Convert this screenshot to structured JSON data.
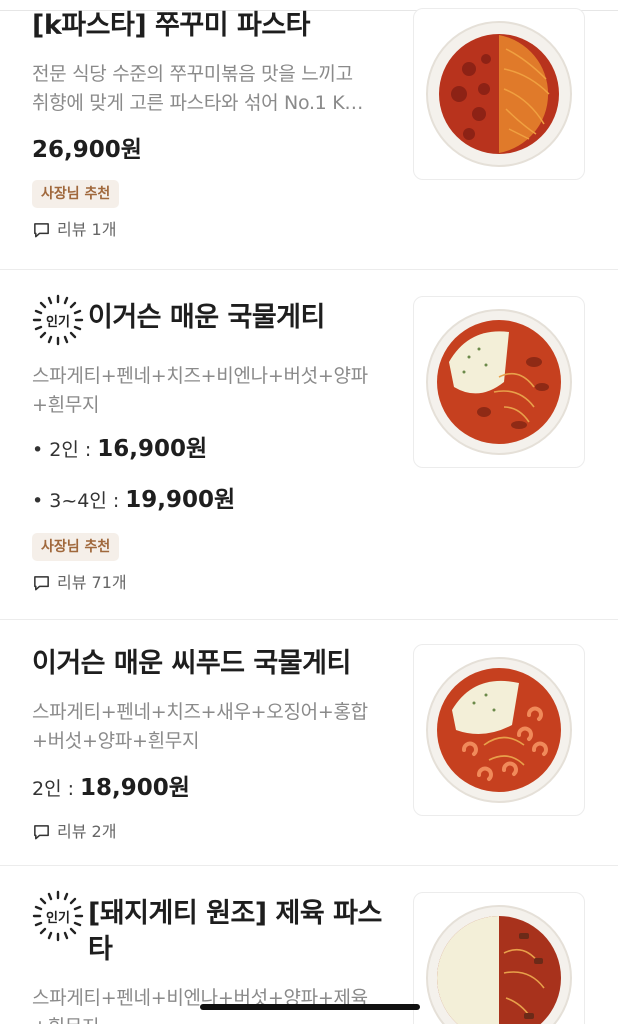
{
  "items": [
    {
      "title": "[k파스타] 쭈꾸미 파스타",
      "desc1": "전문 식당 수준의 쭈꾸미볶음 맛을 느끼고",
      "desc2": "취향에 맞게 고른 파스타와 섞어 No.1 K…",
      "price": "26,900원",
      "badge": "사장님 추천",
      "review": "리뷰 1개"
    },
    {
      "popular_label": "인기",
      "title": "이거슨 매운 국물게티",
      "desc1": "스파게티+펜네+치즈+비엔나+버섯+양파",
      "desc2": "+흰무지",
      "option1_label": "• 2인 :",
      "option1_price": "16,900원",
      "option2_label": "• 3~4인 :",
      "option2_price": "19,900원",
      "badge": "사장님 추천",
      "review": "리뷰 71개"
    },
    {
      "title": "이거슨 매운 씨푸드 국물게티",
      "desc1": "스파게티+펜네+치즈+새우+오징어+홍합",
      "desc2": "+버섯+양파+흰무지",
      "price_label": "2인 :",
      "price": "18,900원",
      "review": "리뷰 2개"
    },
    {
      "popular_label": "인기",
      "title1": "[돼지게티 원조] 제육 파스",
      "title2": "타",
      "desc1": "스파게티+펜네+비엔나+버섯+양파+제육",
      "desc2": "+흰무지"
    }
  ],
  "colors": {
    "badge_bg": "#f5efe9",
    "badge_text": "#a0683c",
    "sauce": "#c8361f",
    "cheese": "#f3efd8"
  }
}
